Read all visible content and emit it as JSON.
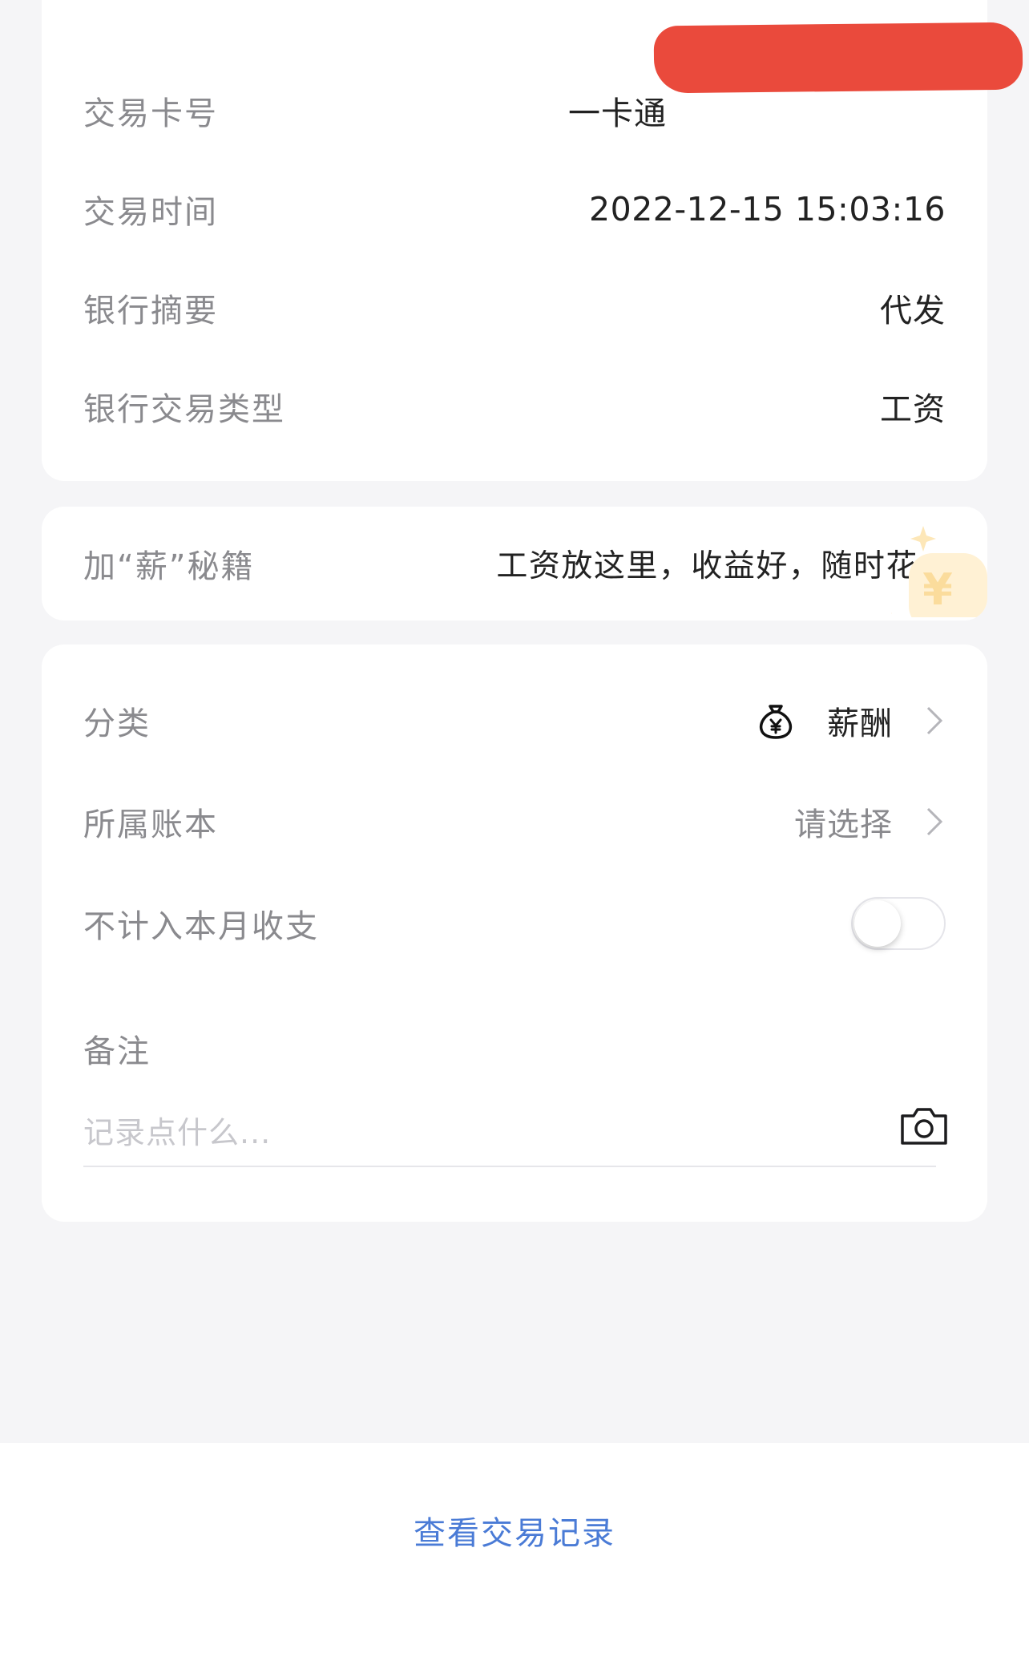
{
  "details": {
    "card_number_label": "交易卡号",
    "card_number_value": "一卡通",
    "time_label": "交易时间",
    "time_value": "2022-12-15 15:03:16",
    "summary_label": "银行摘要",
    "summary_value": "代发",
    "type_label": "银行交易类型",
    "type_value": "工资"
  },
  "promo": {
    "label": "加“薪”秘籍",
    "text": "工资放这里，收益好，随时花>"
  },
  "settings": {
    "category_label": "分类",
    "category_value": "薪酬",
    "category_icon": "money-bag-icon",
    "ledger_label": "所属账本",
    "ledger_value": "请选择",
    "exclude_label": "不计入本月收支",
    "exclude_toggle_on": false,
    "note_label": "备注",
    "note_placeholder": "记录点什么..."
  },
  "footer": {
    "link_label": "查看交易记录",
    "link_color": "#4a7bd6"
  },
  "colors": {
    "redaction": "#ea4a3c",
    "background": "#f5f5f7"
  }
}
